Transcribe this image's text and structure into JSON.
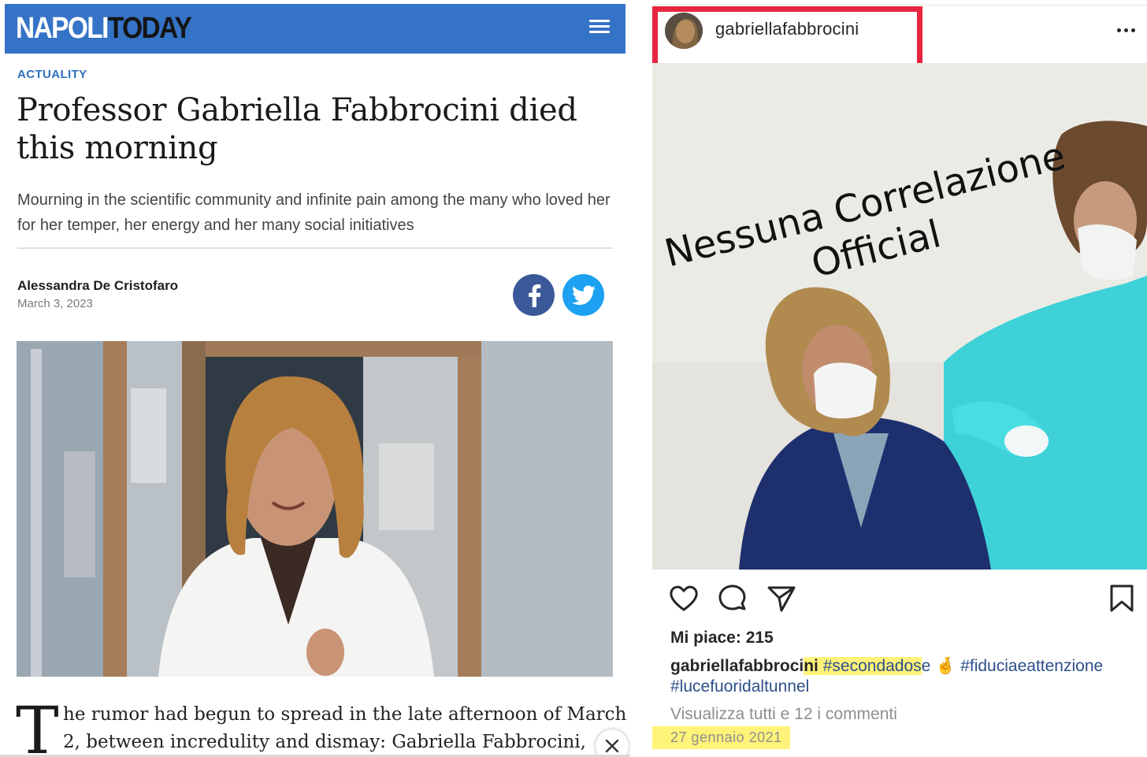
{
  "article": {
    "logo": {
      "part1": "NAPOLI",
      "part2": "TODAY"
    },
    "category": "ACTUALITY",
    "headline": "Professor Gabriella Fabbrocini died this morning",
    "standfirst": "Mourning in the scientific community and infinite pain among the many who loved her for her temper, her energy and her many social initiatives",
    "author": "Alessandra De Cristofaro",
    "date": "March 3, 2023",
    "dropcap": "T",
    "body_line1": "he rumor had begun to spread in the late afternoon of March",
    "body_line2": "2, between incredulity and dismay: Gabriella Fabbrocini,",
    "colors": {
      "brand_blue": "#3573c6",
      "category_blue": "#2f6fc0",
      "facebook": "#3b5998",
      "twitter": "#1da1f2"
    },
    "icons": [
      "menu-icon",
      "facebook-icon",
      "twitter-icon",
      "close-icon"
    ]
  },
  "instagram": {
    "username": "gabriellafabbrocini",
    "overlay_line1": "Nessuna Correlazione",
    "overlay_line2": "Official",
    "likes": "Mi piace: 215",
    "caption_user_a": "gabriellafabbroci",
    "caption_user_b": "ni",
    "caption_tag1_a": "#secondados",
    "caption_tag1_b": "e",
    "caption_emoji": "🤞",
    "caption_tag2": "#fiduciaeattenzione",
    "caption_tag3": "#lucefuoridaltunnel",
    "view_comments": "Visualizza tutti e 12 i commenti",
    "date": "27 gennaio 2021",
    "colors": {
      "highlight_red": "#e8253f",
      "highlight_yellow": "#fff37a",
      "hashtag": "#2d4f8a"
    },
    "icons": [
      "more-icon",
      "heart-icon",
      "comment-icon",
      "share-icon",
      "bookmark-icon"
    ]
  }
}
